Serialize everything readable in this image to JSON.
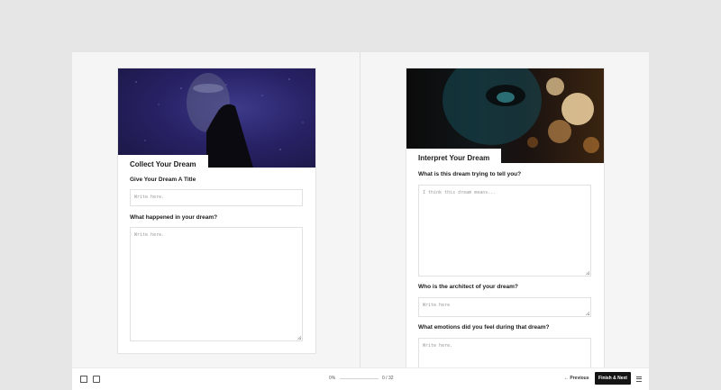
{
  "left_card": {
    "title": "Collect Your Dream",
    "fields": [
      {
        "label": "Give Your Dream A Title",
        "placeholder": "Write here."
      },
      {
        "label": "What happened in your dream?",
        "placeholder": "Write here."
      }
    ]
  },
  "right_card": {
    "title": "Interpret Your Dream",
    "fields": [
      {
        "label": "What is this dream trying to tell you?",
        "placeholder": "I think this dream means..."
      },
      {
        "label": "Who is the architect of your dream?",
        "placeholder": "Write here"
      },
      {
        "label": "What emotions did you feel during that dream?",
        "placeholder": "Write here."
      }
    ]
  },
  "footer": {
    "progress_percent": "0%",
    "progress_value": 0,
    "page_count": "0 / 32",
    "previous_label": "Previous",
    "next_label": "Finish & Next",
    "icons": [
      "grid-icon",
      "layout-icon",
      "arrow-left-icon",
      "menu-icon"
    ]
  },
  "colors": {
    "primary_button": "#141414",
    "background": "#e6e6e6",
    "card": "#ffffff"
  }
}
